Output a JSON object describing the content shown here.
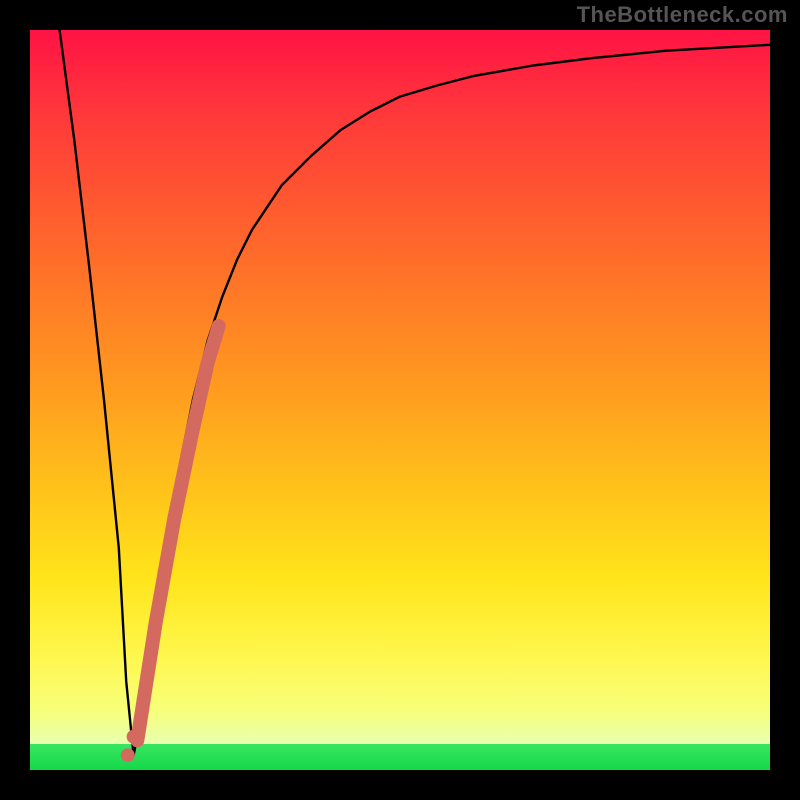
{
  "watermark": "TheBottleneck.com",
  "chart_data": {
    "type": "line",
    "title": "",
    "xlabel": "",
    "ylabel": "",
    "xlim": [
      0,
      100
    ],
    "ylim": [
      0,
      100
    ],
    "grid": false,
    "legend": false,
    "annotations": [],
    "series": [
      {
        "name": "bottleneck-curve",
        "color": "#000000",
        "x": [
          4,
          6,
          8,
          10,
          12,
          13,
          14,
          16,
          18,
          20,
          22,
          24,
          26,
          28,
          30,
          34,
          38,
          42,
          46,
          50,
          55,
          60,
          68,
          76,
          86,
          100
        ],
        "y": [
          100,
          85,
          68,
          50,
          30,
          12,
          2,
          12,
          28,
          40,
          50,
          58,
          64,
          69,
          73,
          79,
          83,
          86.5,
          89,
          91,
          92.5,
          93.8,
          95.2,
          96.2,
          97.2,
          98
        ]
      },
      {
        "name": "highlight-segment",
        "color": "#d46a5f",
        "x": [
          14.5,
          17.0,
          19.5,
          22.0,
          24.0,
          25.5
        ],
        "y": [
          4,
          20,
          34,
          46,
          55,
          60
        ]
      },
      {
        "name": "highlight-dots",
        "color": "#d46a5f",
        "x": [
          13.2,
          14.0
        ],
        "y": [
          2.0,
          4.5
        ]
      }
    ],
    "gradient_stops": [
      {
        "pos": 0.0,
        "color": "#ff1344"
      },
      {
        "pos": 0.3,
        "color": "#ff6a2a"
      },
      {
        "pos": 0.62,
        "color": "#ffc21a"
      },
      {
        "pos": 0.82,
        "color": "#fff23a"
      },
      {
        "pos": 0.965,
        "color": "#e8ffb0"
      },
      {
        "pos": 0.966,
        "color": "#38e660"
      },
      {
        "pos": 1.0,
        "color": "#15d84a"
      }
    ]
  }
}
